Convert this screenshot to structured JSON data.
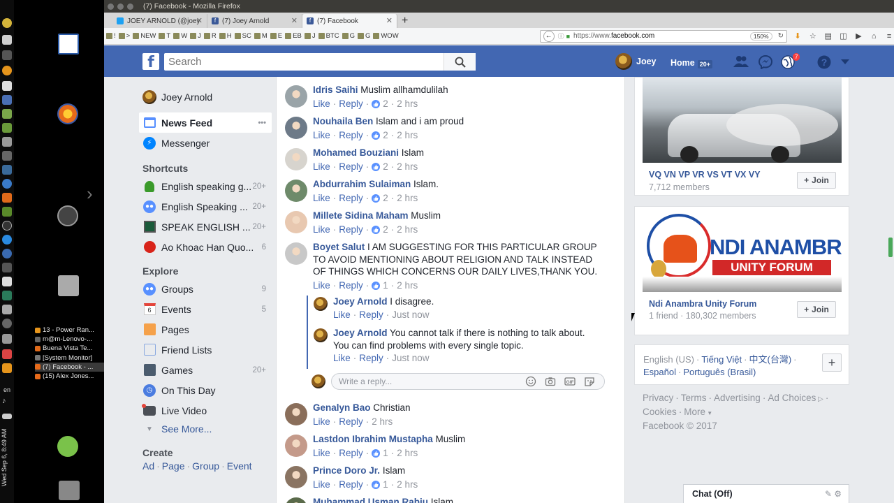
{
  "window": {
    "title": "(7) Facebook - Mozilla Firefox",
    "tabs": [
      {
        "label": "JOEY ARNOLD (@joey",
        "icon": "twitter-icon"
      },
      {
        "label": "(7) Joey Arnold",
        "icon": "facebook-icon"
      },
      {
        "label": "(7) Facebook",
        "icon": "facebook-icon"
      }
    ],
    "new_tab": "+",
    "url_prefix": "https://www.",
    "url_host": "facebook.com",
    "zoom": "150%",
    "bookmarks": [
      "!",
      ">",
      "NEW",
      "T",
      "W",
      "J",
      "R",
      "H",
      "SC",
      "M",
      "E",
      "EB",
      "J",
      "BTC",
      "G",
      "G",
      "WOW"
    ]
  },
  "desktop": {
    "clock": "Wed Sep 6, 8:49 AM",
    "lang": "en",
    "tasks": [
      {
        "label": "13 - Power Ran..."
      },
      {
        "label": "m@m-Lenovo-..."
      },
      {
        "label": "Buena Vista Te..."
      },
      {
        "label": "[System Monitor]"
      },
      {
        "label": "(7) Facebook - ..."
      },
      {
        "label": "(15) Alex Jones..."
      }
    ]
  },
  "header": {
    "search_placeholder": "Search",
    "user_name": "Joey",
    "home_label": "Home",
    "home_count": "20+",
    "notifications_count": "7",
    "accent_color": "#4267b2"
  },
  "leftnav": {
    "profile_name": "Joey Arnold",
    "news_feed": "News Feed",
    "more": "•••",
    "messenger": "Messenger",
    "shortcuts_title": "Shortcuts",
    "shortcuts": [
      {
        "label": "English speaking g...",
        "count": "20+"
      },
      {
        "label": "English Speaking ...",
        "count": "20+"
      },
      {
        "label": "SPEAK ENGLISH ...",
        "count": "20+"
      },
      {
        "label": "Ao Khoac Han Quo...",
        "count": "6"
      }
    ],
    "explore_title": "Explore",
    "explore": [
      {
        "label": "Groups",
        "count": "9"
      },
      {
        "label": "Events",
        "count": "5"
      },
      {
        "label": "Pages",
        "count": ""
      },
      {
        "label": "Friend Lists",
        "count": ""
      },
      {
        "label": "Games",
        "count": "20+"
      },
      {
        "label": "On This Day",
        "count": ""
      },
      {
        "label": "Live Video",
        "count": ""
      }
    ],
    "events_day": "6",
    "see_more": "See More...",
    "create_title": "Create",
    "create_links": [
      "Ad",
      "Page",
      "Group",
      "Event"
    ]
  },
  "feed": {
    "like": "Like",
    "reply": "Reply",
    "comments": [
      {
        "author": "Idris Saihi",
        "text": "Muslim allhamdulilah",
        "likes": "2",
        "time": "2 hrs"
      },
      {
        "author": "Nouhaila Ben",
        "text": "Islam and i am proud",
        "likes": "2",
        "time": "2 hrs"
      },
      {
        "author": "Mohamed Bouziani",
        "text": "Islam",
        "likes": "2",
        "time": "2 hrs"
      },
      {
        "author": "Abdurrahim Sulaiman",
        "text": "Islam.",
        "likes": "2",
        "time": "2 hrs"
      },
      {
        "author": "Millete Sidina Maham",
        "text": "Muslim",
        "likes": "2",
        "time": "2 hrs"
      },
      {
        "author": "Boyet Salut",
        "text": "I AM SUGGESTING FOR THIS PARTICULAR GROUP TO AVOID MENTIONING ABOUT RELIGION AND TALK INSTEAD OF THINGS WHICH CONCERNS OUR DAILY LIVES,THANK YOU.",
        "likes": "1",
        "time": "2 hrs"
      },
      {
        "author": "Genalyn Bao",
        "text": "Christian",
        "likes": "",
        "time": "2 hrs"
      },
      {
        "author": "Lastdon Ibrahim Mustapha",
        "text": "Muslim",
        "likes": "1",
        "time": "2 hrs"
      },
      {
        "author": "Prince Doro Jr.",
        "text": "Islam",
        "likes": "1",
        "time": "2 hrs"
      },
      {
        "author": "Muhammad Usman Rabiu",
        "text": "Islam",
        "likes": "",
        "time": ""
      }
    ],
    "replies": [
      {
        "author": "Joey Arnold",
        "text": "I disagree.",
        "time": "Just now"
      },
      {
        "author": "Joey Arnold",
        "text": "You cannot talk if there is nothing to talk about. You can find problems with every single topic.",
        "time": "Just now"
      }
    ],
    "reply_placeholder": "Write a reply..."
  },
  "right": {
    "groups": [
      {
        "name": "VQ VN VP VR VS VT VX VY",
        "meta": "7,712 members",
        "join": "Join"
      },
      {
        "name": "Ndi Anambra Unity Forum",
        "meta": "1 friend · 180,302 members",
        "join": "Join",
        "banner_line1": "NDI ANAMBRA",
        "banner_line2": "UNITY FORUM"
      }
    ],
    "languages": {
      "current": "English (US)",
      "others": [
        "Tiếng Việt",
        "中文(台灣)",
        "Español",
        "Português (Brasil)"
      ]
    },
    "footer": {
      "links": [
        "Privacy",
        "Terms",
        "Advertising",
        "Ad Choices",
        "Cookies",
        "More"
      ],
      "copyright": "Facebook © 2017"
    },
    "chat": "Chat (Off)"
  }
}
